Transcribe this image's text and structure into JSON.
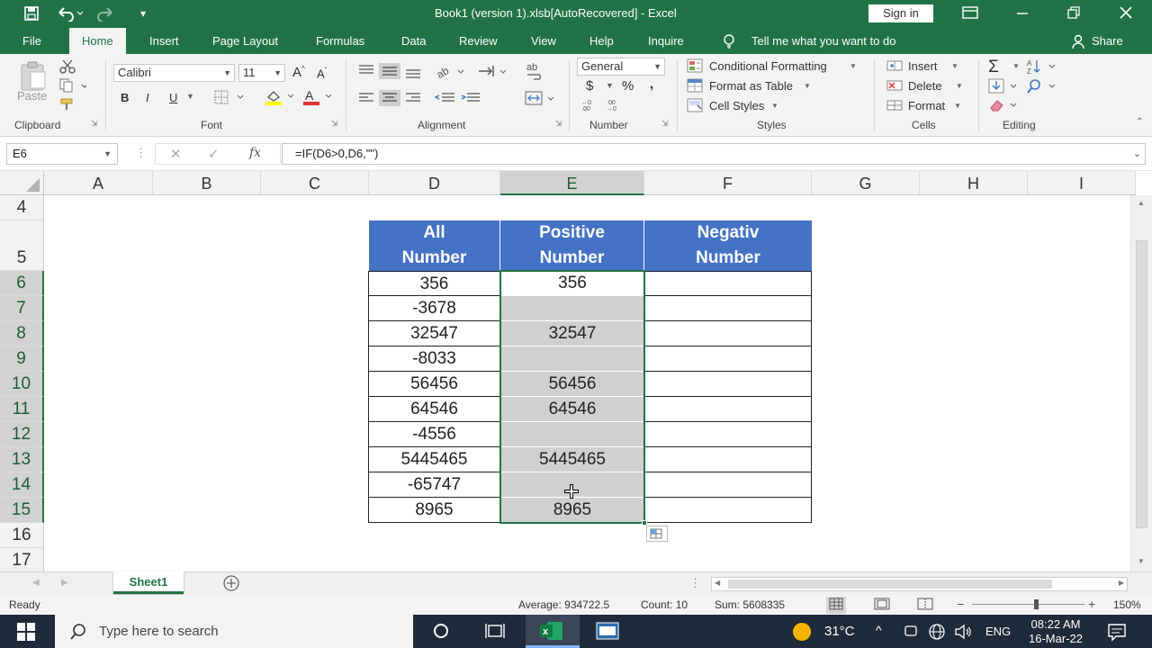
{
  "window": {
    "title": "Book1 (version 1).xlsb[AutoRecovered]  -  Excel",
    "sign_in": "Sign in"
  },
  "tabs": [
    "File",
    "Home",
    "Insert",
    "Page Layout",
    "Formulas",
    "Data",
    "Review",
    "View",
    "Help",
    "Inquire"
  ],
  "tell_me": "Tell me what you want to do",
  "share": "Share",
  "ribbon": {
    "clipboard": {
      "paste": "Paste",
      "label": "Clipboard"
    },
    "font": {
      "name": "Calibri",
      "size": "11",
      "bold": "B",
      "italic": "I",
      "underline": "U",
      "label": "Font"
    },
    "alignment": {
      "label": "Alignment"
    },
    "number": {
      "format": "General",
      "currency": "$",
      "percent": "%",
      "comma": ",",
      "label": "Number"
    },
    "styles": {
      "conditional": "Conditional Formatting",
      "format_table": "Format as Table",
      "cell_styles": "Cell Styles",
      "label": "Styles"
    },
    "cells": {
      "insert": "Insert",
      "delete": "Delete",
      "format": "Format",
      "label": "Cells"
    },
    "editing": {
      "label": "Editing"
    }
  },
  "formula_bar": {
    "name_box": "E6",
    "fx": "fx",
    "formula": "=IF(D6>0,D6,\"\")"
  },
  "columns": [
    "A",
    "B",
    "C",
    "D",
    "E",
    "F",
    "G",
    "H",
    "I"
  ],
  "rows": [
    "4",
    "5",
    "6",
    "7",
    "8",
    "9",
    "10",
    "11",
    "12",
    "13",
    "14",
    "15",
    "16",
    "17"
  ],
  "table": {
    "headers": [
      [
        "All",
        "Number"
      ],
      [
        "Positive",
        "Number"
      ],
      [
        "Negativ",
        "Number"
      ]
    ],
    "all_numbers": [
      "356",
      "-3678",
      "32547",
      "-8033",
      "56456",
      "64546",
      "-4556",
      "5445465",
      "-65747",
      "8965"
    ],
    "positive_numbers": [
      "356",
      "",
      "32547",
      "",
      "56456",
      "64546",
      "",
      "5445465",
      "",
      "8965"
    ]
  },
  "sheet_tab": "Sheet1",
  "status": {
    "ready": "Ready",
    "average": "Average: 934722.5",
    "count": "Count: 10",
    "sum": "Sum: 5608335",
    "zoom": "150%"
  },
  "taskbar": {
    "search": "Type here to search",
    "temp": "31°C",
    "lang": "ENG",
    "time": "08:22 AM",
    "date": "16-Mar-22"
  }
}
